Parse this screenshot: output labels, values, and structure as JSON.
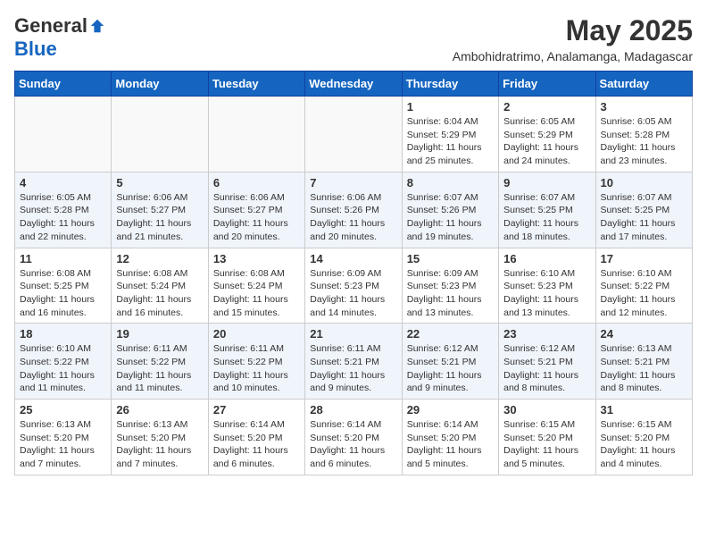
{
  "logo": {
    "general": "General",
    "blue": "Blue"
  },
  "header": {
    "month": "May 2025",
    "subtitle": "Ambohidratrimo, Analamanga, Madagascar"
  },
  "weekdays": [
    "Sunday",
    "Monday",
    "Tuesday",
    "Wednesday",
    "Thursday",
    "Friday",
    "Saturday"
  ],
  "weeks": [
    [
      {
        "day": "",
        "info": ""
      },
      {
        "day": "",
        "info": ""
      },
      {
        "day": "",
        "info": ""
      },
      {
        "day": "",
        "info": ""
      },
      {
        "day": "1",
        "info": "Sunrise: 6:04 AM\nSunset: 5:29 PM\nDaylight: 11 hours\nand 25 minutes."
      },
      {
        "day": "2",
        "info": "Sunrise: 6:05 AM\nSunset: 5:29 PM\nDaylight: 11 hours\nand 24 minutes."
      },
      {
        "day": "3",
        "info": "Sunrise: 6:05 AM\nSunset: 5:28 PM\nDaylight: 11 hours\nand 23 minutes."
      }
    ],
    [
      {
        "day": "4",
        "info": "Sunrise: 6:05 AM\nSunset: 5:28 PM\nDaylight: 11 hours\nand 22 minutes."
      },
      {
        "day": "5",
        "info": "Sunrise: 6:06 AM\nSunset: 5:27 PM\nDaylight: 11 hours\nand 21 minutes."
      },
      {
        "day": "6",
        "info": "Sunrise: 6:06 AM\nSunset: 5:27 PM\nDaylight: 11 hours\nand 20 minutes."
      },
      {
        "day": "7",
        "info": "Sunrise: 6:06 AM\nSunset: 5:26 PM\nDaylight: 11 hours\nand 20 minutes."
      },
      {
        "day": "8",
        "info": "Sunrise: 6:07 AM\nSunset: 5:26 PM\nDaylight: 11 hours\nand 19 minutes."
      },
      {
        "day": "9",
        "info": "Sunrise: 6:07 AM\nSunset: 5:25 PM\nDaylight: 11 hours\nand 18 minutes."
      },
      {
        "day": "10",
        "info": "Sunrise: 6:07 AM\nSunset: 5:25 PM\nDaylight: 11 hours\nand 17 minutes."
      }
    ],
    [
      {
        "day": "11",
        "info": "Sunrise: 6:08 AM\nSunset: 5:25 PM\nDaylight: 11 hours\nand 16 minutes."
      },
      {
        "day": "12",
        "info": "Sunrise: 6:08 AM\nSunset: 5:24 PM\nDaylight: 11 hours\nand 16 minutes."
      },
      {
        "day": "13",
        "info": "Sunrise: 6:08 AM\nSunset: 5:24 PM\nDaylight: 11 hours\nand 15 minutes."
      },
      {
        "day": "14",
        "info": "Sunrise: 6:09 AM\nSunset: 5:23 PM\nDaylight: 11 hours\nand 14 minutes."
      },
      {
        "day": "15",
        "info": "Sunrise: 6:09 AM\nSunset: 5:23 PM\nDaylight: 11 hours\nand 13 minutes."
      },
      {
        "day": "16",
        "info": "Sunrise: 6:10 AM\nSunset: 5:23 PM\nDaylight: 11 hours\nand 13 minutes."
      },
      {
        "day": "17",
        "info": "Sunrise: 6:10 AM\nSunset: 5:22 PM\nDaylight: 11 hours\nand 12 minutes."
      }
    ],
    [
      {
        "day": "18",
        "info": "Sunrise: 6:10 AM\nSunset: 5:22 PM\nDaylight: 11 hours\nand 11 minutes."
      },
      {
        "day": "19",
        "info": "Sunrise: 6:11 AM\nSunset: 5:22 PM\nDaylight: 11 hours\nand 11 minutes."
      },
      {
        "day": "20",
        "info": "Sunrise: 6:11 AM\nSunset: 5:22 PM\nDaylight: 11 hours\nand 10 minutes."
      },
      {
        "day": "21",
        "info": "Sunrise: 6:11 AM\nSunset: 5:21 PM\nDaylight: 11 hours\nand 9 minutes."
      },
      {
        "day": "22",
        "info": "Sunrise: 6:12 AM\nSunset: 5:21 PM\nDaylight: 11 hours\nand 9 minutes."
      },
      {
        "day": "23",
        "info": "Sunrise: 6:12 AM\nSunset: 5:21 PM\nDaylight: 11 hours\nand 8 minutes."
      },
      {
        "day": "24",
        "info": "Sunrise: 6:13 AM\nSunset: 5:21 PM\nDaylight: 11 hours\nand 8 minutes."
      }
    ],
    [
      {
        "day": "25",
        "info": "Sunrise: 6:13 AM\nSunset: 5:20 PM\nDaylight: 11 hours\nand 7 minutes."
      },
      {
        "day": "26",
        "info": "Sunrise: 6:13 AM\nSunset: 5:20 PM\nDaylight: 11 hours\nand 7 minutes."
      },
      {
        "day": "27",
        "info": "Sunrise: 6:14 AM\nSunset: 5:20 PM\nDaylight: 11 hours\nand 6 minutes."
      },
      {
        "day": "28",
        "info": "Sunrise: 6:14 AM\nSunset: 5:20 PM\nDaylight: 11 hours\nand 6 minutes."
      },
      {
        "day": "29",
        "info": "Sunrise: 6:14 AM\nSunset: 5:20 PM\nDaylight: 11 hours\nand 5 minutes."
      },
      {
        "day": "30",
        "info": "Sunrise: 6:15 AM\nSunset: 5:20 PM\nDaylight: 11 hours\nand 5 minutes."
      },
      {
        "day": "31",
        "info": "Sunrise: 6:15 AM\nSunset: 5:20 PM\nDaylight: 11 hours\nand 4 minutes."
      }
    ]
  ]
}
